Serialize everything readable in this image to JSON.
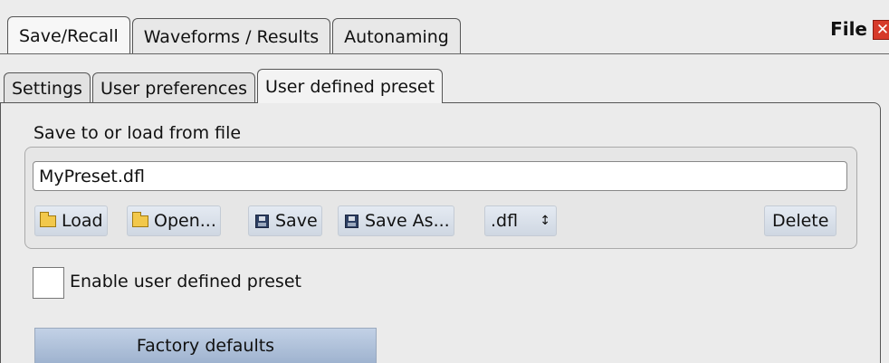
{
  "window": {
    "title": "File",
    "close_icon": "close-icon"
  },
  "main_tabs": [
    {
      "label": "Save/Recall",
      "active": true
    },
    {
      "label": "Waveforms / Results",
      "active": false
    },
    {
      "label": "Autonaming",
      "active": false
    }
  ],
  "sub_tabs": [
    {
      "label": "Settings",
      "active": false
    },
    {
      "label": "User preferences",
      "active": false
    },
    {
      "label": "User defined preset",
      "active": true
    }
  ],
  "file_section": {
    "label": "Save to or load from file",
    "filename": "MyPreset.dfl",
    "buttons": {
      "load": "Load",
      "open": "Open...",
      "save": "Save",
      "save_as": "Save As...",
      "delete": "Delete"
    },
    "extension": ".dfl",
    "extension_arrow": "↕"
  },
  "enable_preset": {
    "label": "Enable user defined preset",
    "checked": false
  },
  "factory_defaults": {
    "label": "Factory defaults"
  },
  "colors": {
    "accent_button": "#b5c6df",
    "close": "#d63a2a"
  }
}
